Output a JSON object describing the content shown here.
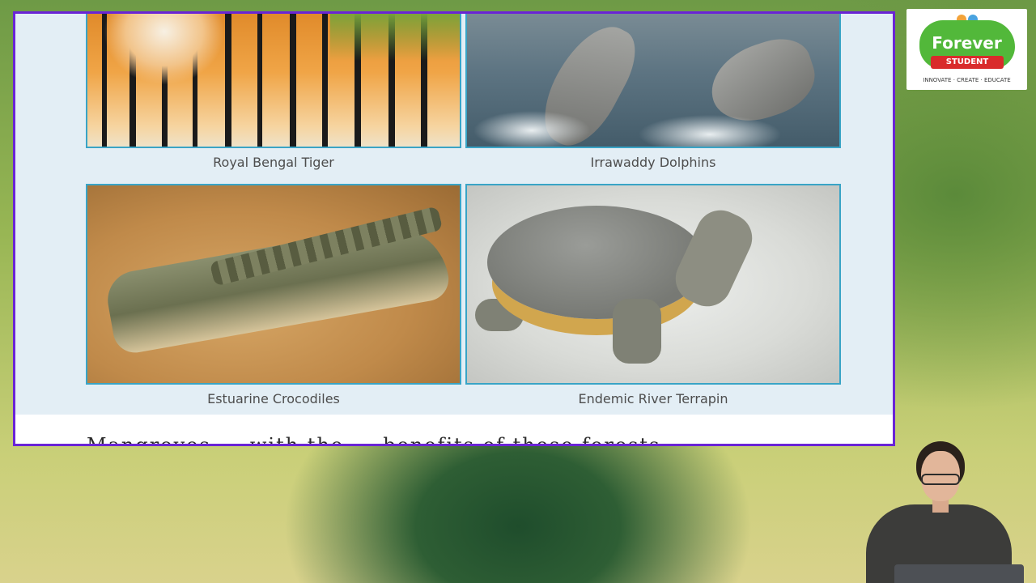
{
  "slide": {
    "panels": [
      {
        "caption": "Royal Bengal Tiger"
      },
      {
        "caption": "Irrawaddy Dolphins"
      },
      {
        "caption": "Estuarine Crocodiles"
      },
      {
        "caption": "Endemic River Terrapin"
      }
    ],
    "next_text": "Mangroves ... with the ... benefits of these forests"
  },
  "logo": {
    "word": "Forever",
    "ribbon": "STUDENT",
    "tagline": "INNOVATE · CREATE · EDUCATE"
  },
  "colors": {
    "slide_border": "#6a24d6",
    "photo_border": "#39a4c6",
    "logo_green": "#52b83a",
    "logo_red": "#d92b2b"
  }
}
